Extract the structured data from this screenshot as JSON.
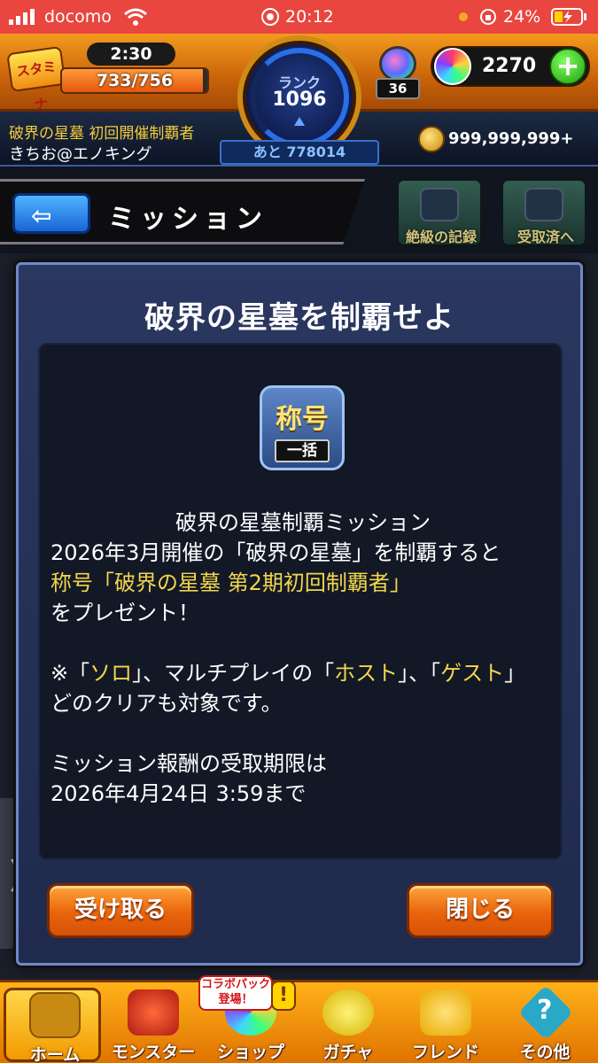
{
  "status_bar": {
    "carrier": "docomo",
    "time": "20:12",
    "battery": "24%",
    "icons": [
      "signal-icon",
      "wifi-icon",
      "screen-record-icon",
      "orientation-lock-icon",
      "battery-charging-icon"
    ]
  },
  "hud": {
    "stamina_badge": "スタミナ",
    "stamina_timer": "2:30",
    "stamina_value": "733/756",
    "stamina_current": 733,
    "stamina_max": 756,
    "rank_label": "ランク",
    "rank_value": "1096",
    "exp_remaining": "あと 778014",
    "potion_count": "36",
    "orb_count": "2270",
    "orb_add": "+",
    "player_title": "破界の星墓 初回開催制覇者",
    "player_name": "きちお@エノキング",
    "gold_count": "999,999,999+"
  },
  "header": {
    "back_arrow": "⇦",
    "title": "ミッション",
    "records_label": "絶級の記録",
    "received_label": "受取済へ"
  },
  "modal": {
    "title": "破界の星墓を制覇せよ",
    "badge_top": "称号",
    "badge_bottom": "一括",
    "mission_name": "破界の星墓制覇ミッション",
    "line1": "2026年3月開催の「破界の星墓」を制覇すると",
    "line2": "称号「破界の星墓 第2期初回制覇者」",
    "line3": "をプレゼント！",
    "note_prefix": "※「",
    "note_solo": "ソロ",
    "note_mid1": "」、マルチプレイの「",
    "note_host": "ホスト",
    "note_mid2": "」、「",
    "note_guest": "ゲスト",
    "note_end": "」",
    "note_line2": "どのクリアも対象です。",
    "deadline_line1": "ミッション報酬の受取期限は",
    "deadline_line2": "2026年4月24日 3:59まで",
    "receive_button": "受け取る",
    "close_button": "閉じる"
  },
  "side_tab": "〉",
  "bottom_nav": {
    "home": "ホーム",
    "monster": "モンスター",
    "shop": "ショップ",
    "shop_tag": "コラボパック登場！",
    "shop_alert": "!",
    "gacha": "ガチャ",
    "friend": "フレンド",
    "other": "その他",
    "other_glyph": "?"
  },
  "colors": {
    "status_bar": "#e8463f",
    "accent_orange": "#e8640c",
    "highlight_yellow": "#f3d64b",
    "modal_bg": "#1f2a4c"
  }
}
